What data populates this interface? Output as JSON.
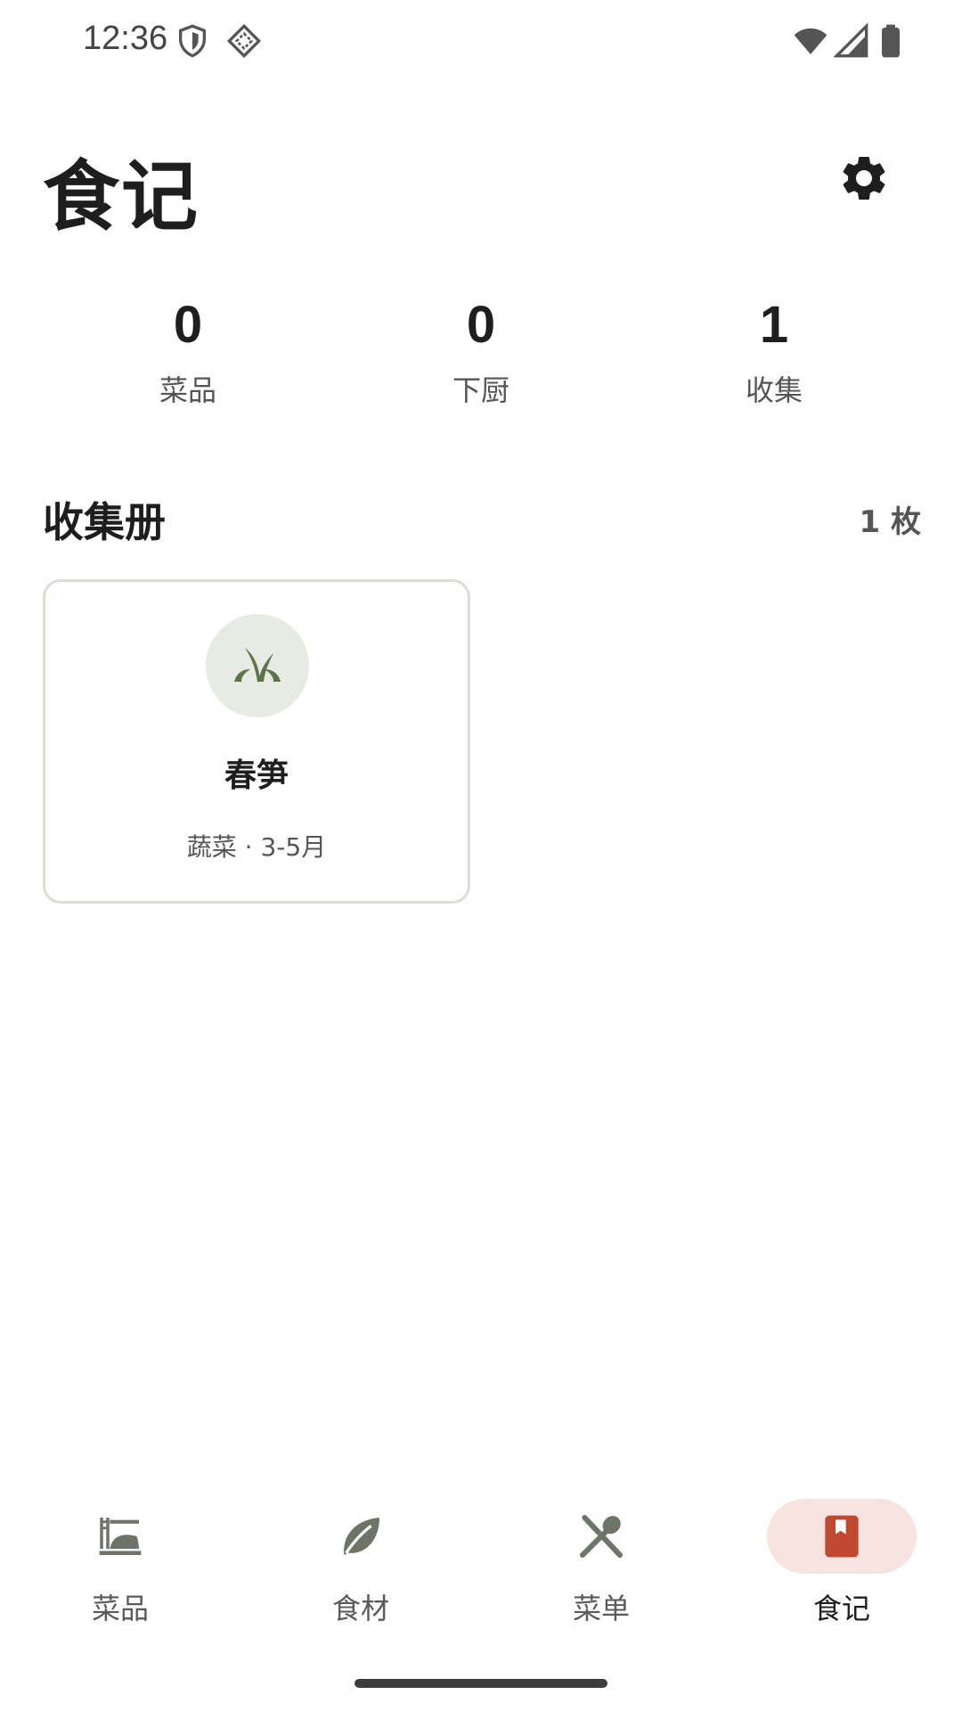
{
  "status_bar": {
    "time": "12:36",
    "left_icons": [
      "shield-icon",
      "vpn-diamond-icon"
    ],
    "right_icons": [
      "wifi-icon",
      "cellular-signal-icon",
      "battery-icon"
    ]
  },
  "header": {
    "title": "食记",
    "settings_icon": "gear-icon"
  },
  "stats": [
    {
      "value": "0",
      "label": "菜品"
    },
    {
      "value": "0",
      "label": "下厨"
    },
    {
      "value": "1",
      "label": "收集"
    }
  ],
  "collection": {
    "title": "收集册",
    "count": "1 枚",
    "cards": [
      {
        "icon": "sprout-icon",
        "name": "春笋",
        "subtitle": "蔬菜 · 3-5月"
      }
    ]
  },
  "bottom_nav": {
    "items": [
      {
        "label": "菜品",
        "icon": "dish-icon",
        "active": false
      },
      {
        "label": "食材",
        "icon": "leaf-icon",
        "active": false
      },
      {
        "label": "菜单",
        "icon": "utensils-icon",
        "active": false
      },
      {
        "label": "食记",
        "icon": "bookmark-book-icon",
        "active": true
      }
    ]
  },
  "colors": {
    "accent": "#c0482f",
    "active_pill": "#f7e3df",
    "sprout_green": "#5d7448",
    "avatar_bg": "#e8ebe3",
    "nav_icon_gray": "#6e7568"
  }
}
